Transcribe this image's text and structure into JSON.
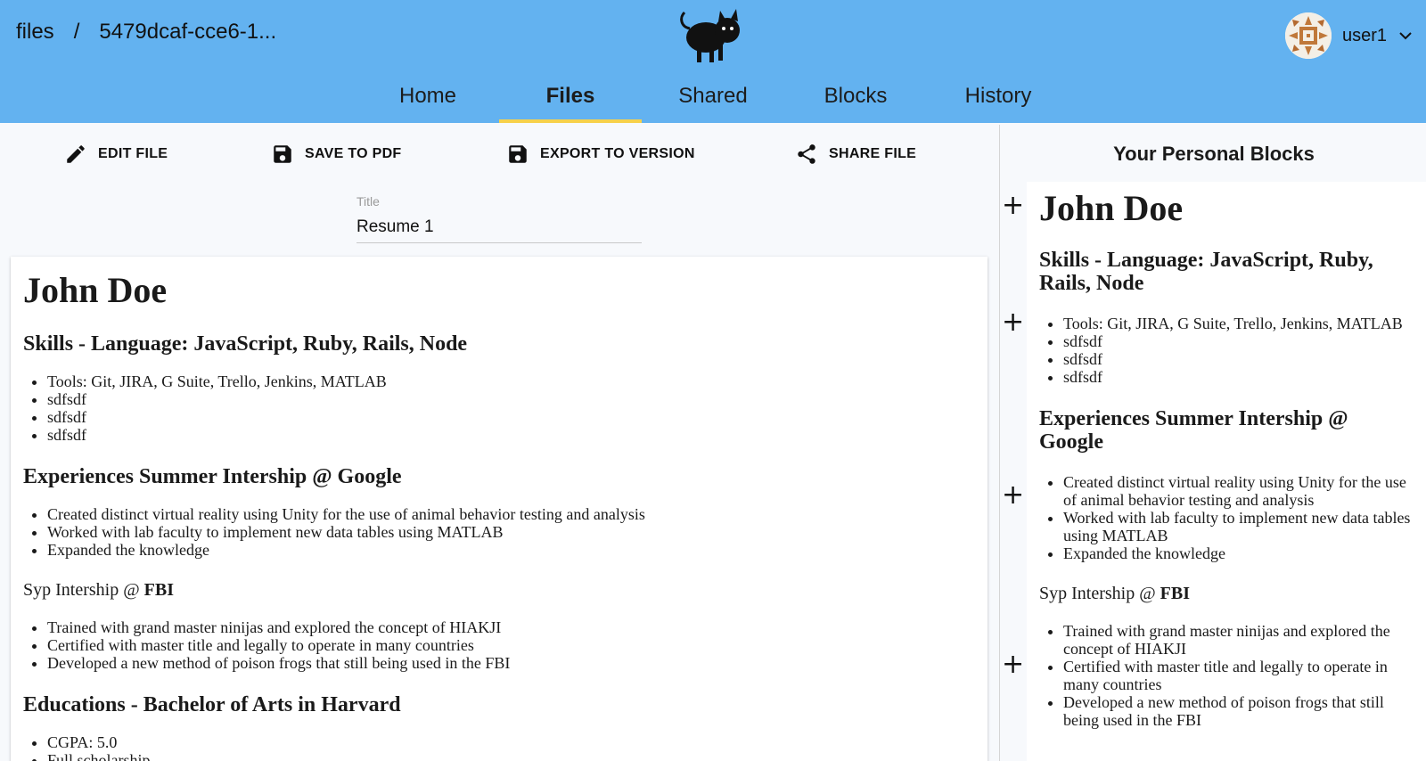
{
  "header": {
    "breadcrumb_root": "files",
    "breadcrumb_sep": "/",
    "breadcrumb_file": "5479dcaf-cce6-1...",
    "username": "user1",
    "logo_icon": "cat-icon",
    "avatar_icon": "avatar-pattern"
  },
  "tabs": [
    {
      "label": "Home"
    },
    {
      "label": "Files"
    },
    {
      "label": "Shared"
    },
    {
      "label": "Blocks"
    },
    {
      "label": "History"
    }
  ],
  "active_tab": "Files",
  "toolbar": {
    "edit": "EDIT FILE",
    "save_pdf": "SAVE TO PDF",
    "export": "EXPORT TO VERSION",
    "share": "SHARE FILE"
  },
  "title_field": {
    "label": "Title",
    "value": "Resume 1"
  },
  "document": {
    "name": "John Doe",
    "skills_heading": "Skills - Language: JavaScript, Ruby, Rails, Node",
    "skills": [
      "Tools: Git, JIRA, G Suite, Trello, Jenkins, MATLAB",
      "sdfsdf",
      "sdfsdf",
      "sdfsdf"
    ],
    "exp_heading": "Experiences Summer Intership @ Google",
    "exp_items": [
      "Created distinct virtual reality using Unity for the use of animal behavior testing and analysis",
      "Worked with lab faculty to implement new data tables using MATLAB",
      "Expanded the knowledge"
    ],
    "syp_prefix": "Syp Intership @ ",
    "syp_bold": "FBI",
    "fbi_items": [
      "Trained with grand master ninijas and explored the concept of HIAKJI",
      "Certified with master title and legally to operate in many countries",
      "Developed a new method of poison frogs that still being used in the FBI"
    ],
    "edu_heading": "Educations - Bachelor of Arts in Harvard",
    "edu_items": [
      "CGPA: 5.0",
      "Full scholarship"
    ]
  },
  "side_panel": {
    "title": "Your Personal Blocks",
    "add_symbol": "+"
  }
}
